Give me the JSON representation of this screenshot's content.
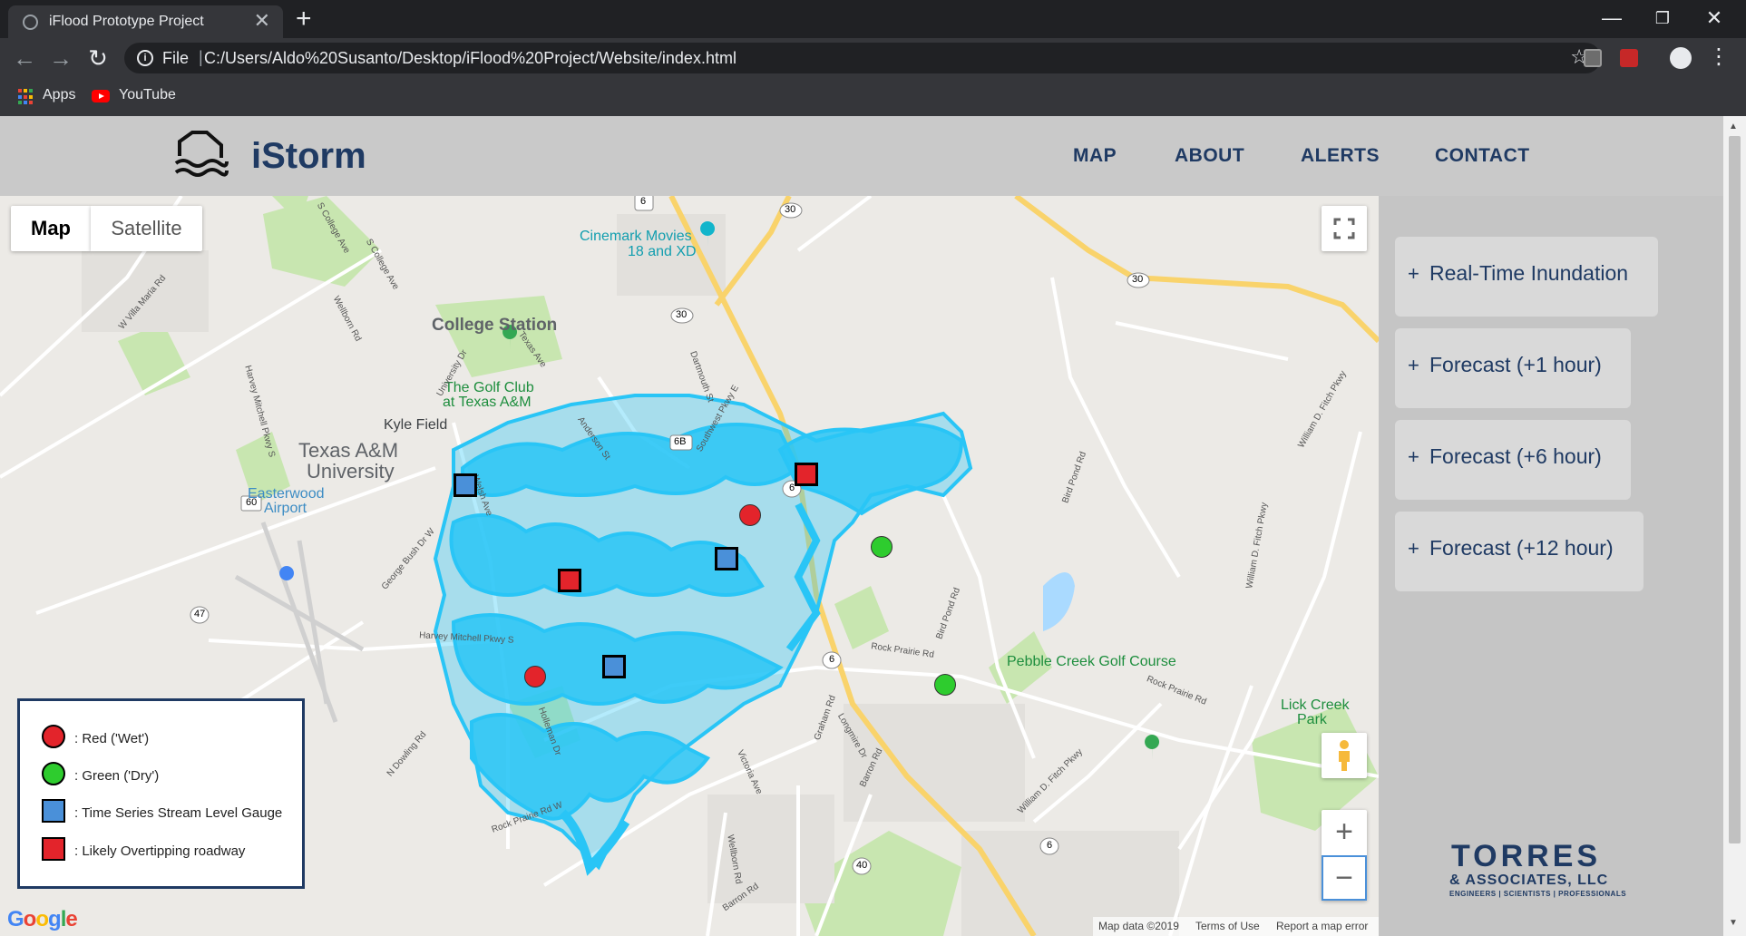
{
  "browser": {
    "tab_title": "iFlood Prototype Project",
    "tab_close": "✕",
    "new_tab": "+",
    "url_scheme_label": "File",
    "url": "C:/Users/Aldo%20Susanto/Desktop/iFlood%20Project/Website/index.html",
    "bookmarks": {
      "apps": "Apps",
      "youtube": "YouTube"
    },
    "window_controls": {
      "minimize": "—",
      "restore": "❐",
      "close": "✕"
    }
  },
  "header": {
    "brand": "iStorm",
    "nav": {
      "map": "MAP",
      "about": "ABOUT",
      "alerts": "ALERTS",
      "contact": "CONTACT"
    }
  },
  "map": {
    "type_controls": {
      "map": "Map",
      "satellite": "Satellite"
    },
    "selected_type": "Map",
    "labels": {
      "college_station": "College Station",
      "cinemark_1": "Cinemark Movies",
      "cinemark_2": "18 and XD",
      "golf_club_1": "The Golf Club",
      "golf_club_2": "at Texas A&M",
      "kyle_field": "Kyle Field",
      "tamu_1": "Texas A&M",
      "tamu_2": "University",
      "easterwood_1": "Easterwood",
      "easterwood_2": "Airport",
      "pebble_creek": "Pebble Creek Golf Course",
      "lick_creek_1": "Lick Creek",
      "lick_creek_2": "Park",
      "rock_prairie": "Rock Prairie Rd",
      "harvey_mitchell": "Harvey Mitchell Pkwy S",
      "wellborn": "Wellborn Rd",
      "texas_ave": "Texas Ave",
      "university_dr": "University Dr",
      "george_bush": "George Bush Dr W",
      "bird_pond": "Bird Pond Rd",
      "william_fitch": "William D. Fitch Pkwy",
      "barron": "Barron Rd",
      "victoria": "Victoria Ave",
      "graham": "Graham Rd",
      "longmire": "Longmire Dr",
      "dowling": "N Dowling Rd",
      "rock_prairie_w": "Rock Prairie Rd W",
      "holleman": "Holleman Dr",
      "welsh": "Welsh Ave",
      "dartmouth": "Dartmouth St",
      "southwest": "Southwest Pkwy E",
      "villa_maria": "W Villa Maria Rd",
      "college_ave": "S College Ave",
      "anderson": "Anderson St",
      "langford": "Longmire Dr"
    },
    "road_shields": {
      "h6_top": "6",
      "h30_top": "30",
      "h30_mid": "30",
      "h30_right": "30",
      "h6b": "6B",
      "h6_mid": "6",
      "h6_low": "6",
      "h6_bottom": "6",
      "h60": "60",
      "h47": "47",
      "h40": "40"
    },
    "attribution": {
      "data": "Map data ©2019",
      "terms": "Terms of Use",
      "report": "Report a map error"
    },
    "google": [
      "G",
      "o",
      "o",
      "g",
      "l",
      "e"
    ],
    "zoom_in": "+",
    "zoom_out": "−"
  },
  "legend": {
    "items": [
      {
        "label": ": Red ('Wet')",
        "shape": "circle",
        "color": "#e3242b"
      },
      {
        "label": ": Green ('Dry')",
        "shape": "circle",
        "color": "#2ecc2e"
      },
      {
        "label": ": Time Series Stream Level Gauge",
        "shape": "square",
        "color": "#4a90d9"
      },
      {
        "label": ": Likely Overtipping roadway",
        "shape": "square",
        "color": "#e3242b"
      }
    ]
  },
  "markers": {
    "red_circles": 2,
    "green_circles": 2,
    "blue_squares": 3,
    "red_squares": 2
  },
  "layers": [
    {
      "plus": "+",
      "label": "Real-Time Inundation"
    },
    {
      "plus": "+",
      "label": "Forecast (+1 hour)"
    },
    {
      "plus": "+",
      "label": "Forecast (+6 hour)"
    },
    {
      "plus": "+",
      "label": "Forecast (+12 hour)"
    }
  ],
  "sponsor": {
    "line1": "TORRES",
    "line2": "& ASSOCIATES, LLC",
    "line3": "ENGINEERS | SCIENTISTS | PROFESSIONALS"
  },
  "colors": {
    "brand_navy": "#1f3a63",
    "flood_blue": "#29c5f6",
    "wet_red": "#e3242b",
    "dry_green": "#2ecc2e",
    "gauge_blue": "#4a90d9"
  },
  "icons": {
    "back": "back-arrow-icon",
    "forward": "forward-arrow-icon",
    "reload": "reload-icon",
    "info": "info-icon",
    "star": "bookmark-star-icon",
    "profile": "profile-icon",
    "menu": "menu-dots-icon",
    "house": "house-flood-icon",
    "fullscreen": "fullscreen-icon",
    "pegman": "pegman-icon"
  }
}
